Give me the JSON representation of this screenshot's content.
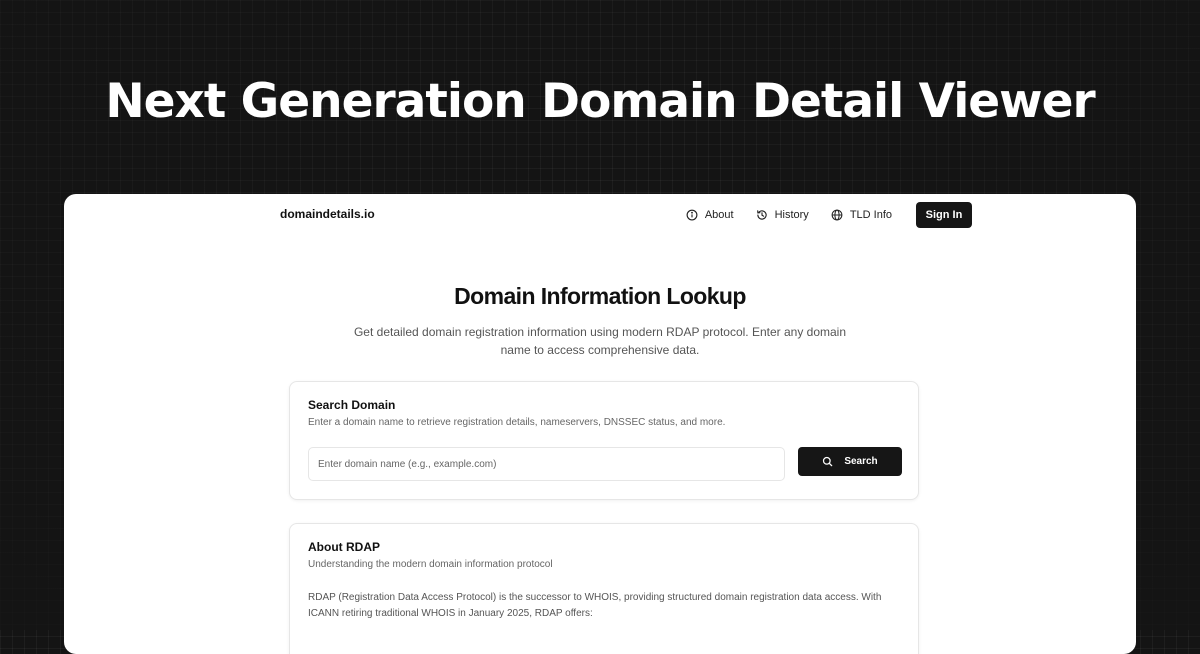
{
  "hero": {
    "title": "Next Generation Domain Detail Viewer"
  },
  "nav": {
    "brand": "domaindetails.io",
    "links": [
      {
        "label": "About",
        "icon": "info-icon"
      },
      {
        "label": "History",
        "icon": "history-icon"
      },
      {
        "label": "TLD Info",
        "icon": "globe-icon"
      }
    ],
    "signin_label": "Sign In"
  },
  "main": {
    "title": "Domain Information Lookup",
    "subtitle": "Get detailed domain registration information using modern RDAP protocol. Enter any domain name to access comprehensive data."
  },
  "search_card": {
    "title": "Search Domain",
    "description": "Enter a domain name to retrieve registration details, nameservers, DNSSEC status, and more.",
    "input_placeholder": "Enter domain name (e.g., example.com)",
    "input_value": "",
    "button_label": "Search",
    "button_icon": "search-icon"
  },
  "about_card": {
    "title": "About RDAP",
    "description": "Understanding the modern domain information protocol",
    "body": "RDAP (Registration Data Access Protocol) is the successor to WHOIS, providing structured domain registration data access. With ICANN retiring traditional WHOIS in January 2025, RDAP offers:"
  },
  "colors": {
    "background": "#141414",
    "card": "#ffffff",
    "primary_button": "#161616",
    "hero_text": "#ffffff"
  }
}
